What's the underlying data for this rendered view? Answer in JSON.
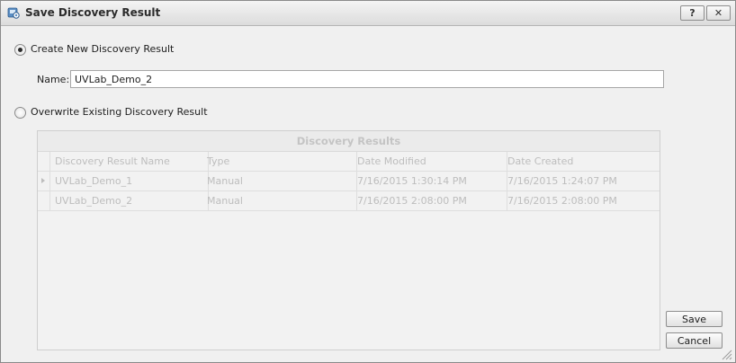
{
  "window": {
    "title": "Save Discovery Result",
    "help_label": "?",
    "close_label": "✕"
  },
  "create_option": {
    "label": "Create New Discovery Result",
    "selected": true
  },
  "name_field": {
    "label": "Name:",
    "value": "UVLab_Demo_2"
  },
  "overwrite_option": {
    "label": "Overwrite Existing Discovery Result",
    "selected": false
  },
  "results_grid": {
    "title": "Discovery Results",
    "columns": [
      "Discovery Result Name",
      "Type",
      "Date Modified",
      "Date Created"
    ],
    "rows": [
      [
        "UVLab_Demo_1",
        "Manual",
        "7/16/2015 1:30:14 PM",
        "7/16/2015 1:24:07 PM"
      ],
      [
        "UVLab_Demo_2",
        "Manual",
        "7/16/2015 2:08:00 PM",
        "7/16/2015 2:08:00 PM"
      ]
    ]
  },
  "buttons": {
    "save_label": "Save",
    "cancel_label": "Cancel"
  },
  "icons": {
    "app": "discovery-app-icon",
    "row_indicator": "row-pointer-icon",
    "resize": "resize-grip-icon"
  },
  "colors": {
    "disabled_text": "#bdbdbd",
    "window_background": "#f0f0f0"
  }
}
